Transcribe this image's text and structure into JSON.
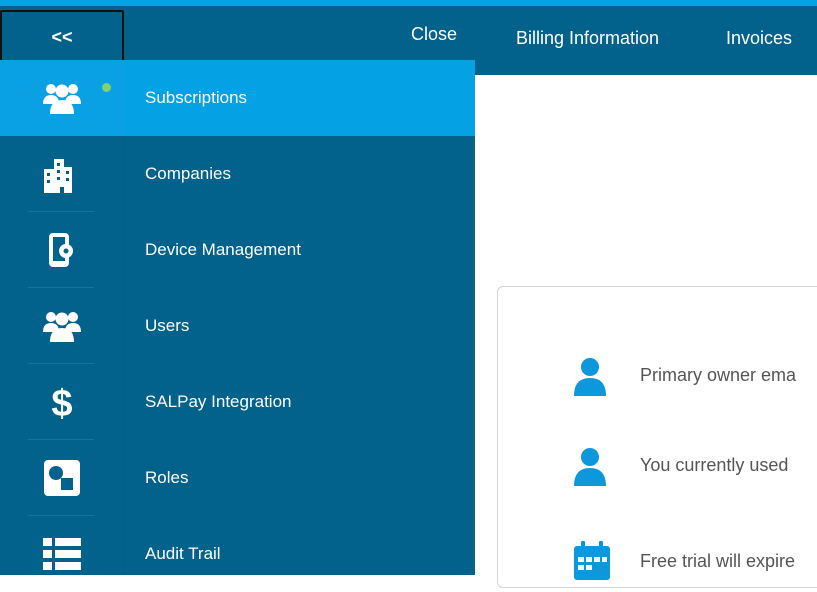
{
  "header": {
    "collapse_label": "<<",
    "close_label": "Close",
    "tabs": [
      {
        "label": "Billing Information"
      },
      {
        "label": "Invoices"
      }
    ]
  },
  "sidebar": {
    "items": [
      {
        "label": "Subscriptions",
        "icon": "users-group-icon",
        "active": true
      },
      {
        "label": "Companies",
        "icon": "building-icon"
      },
      {
        "label": "Device Management",
        "icon": "mobile-gear-icon"
      },
      {
        "label": "Users",
        "icon": "users-group-icon"
      },
      {
        "label": "SALPay Integration",
        "icon": "dollar-icon"
      },
      {
        "label": "Roles",
        "icon": "roles-icon"
      },
      {
        "label": "Audit Trail",
        "icon": "list-icon"
      }
    ]
  },
  "main": {
    "info_rows": [
      {
        "icon": "user-icon",
        "text": "Primary owner ema"
      },
      {
        "icon": "user-icon",
        "text": "You currently used "
      },
      {
        "icon": "calendar-icon",
        "text": "Free trial will expire"
      }
    ]
  },
  "colors": {
    "header": "#02628c",
    "active": "#04a1e5",
    "accent_strip": "#0aa0e4",
    "status_dot": "#7ed36b",
    "info_icon": "#0e98dc"
  }
}
